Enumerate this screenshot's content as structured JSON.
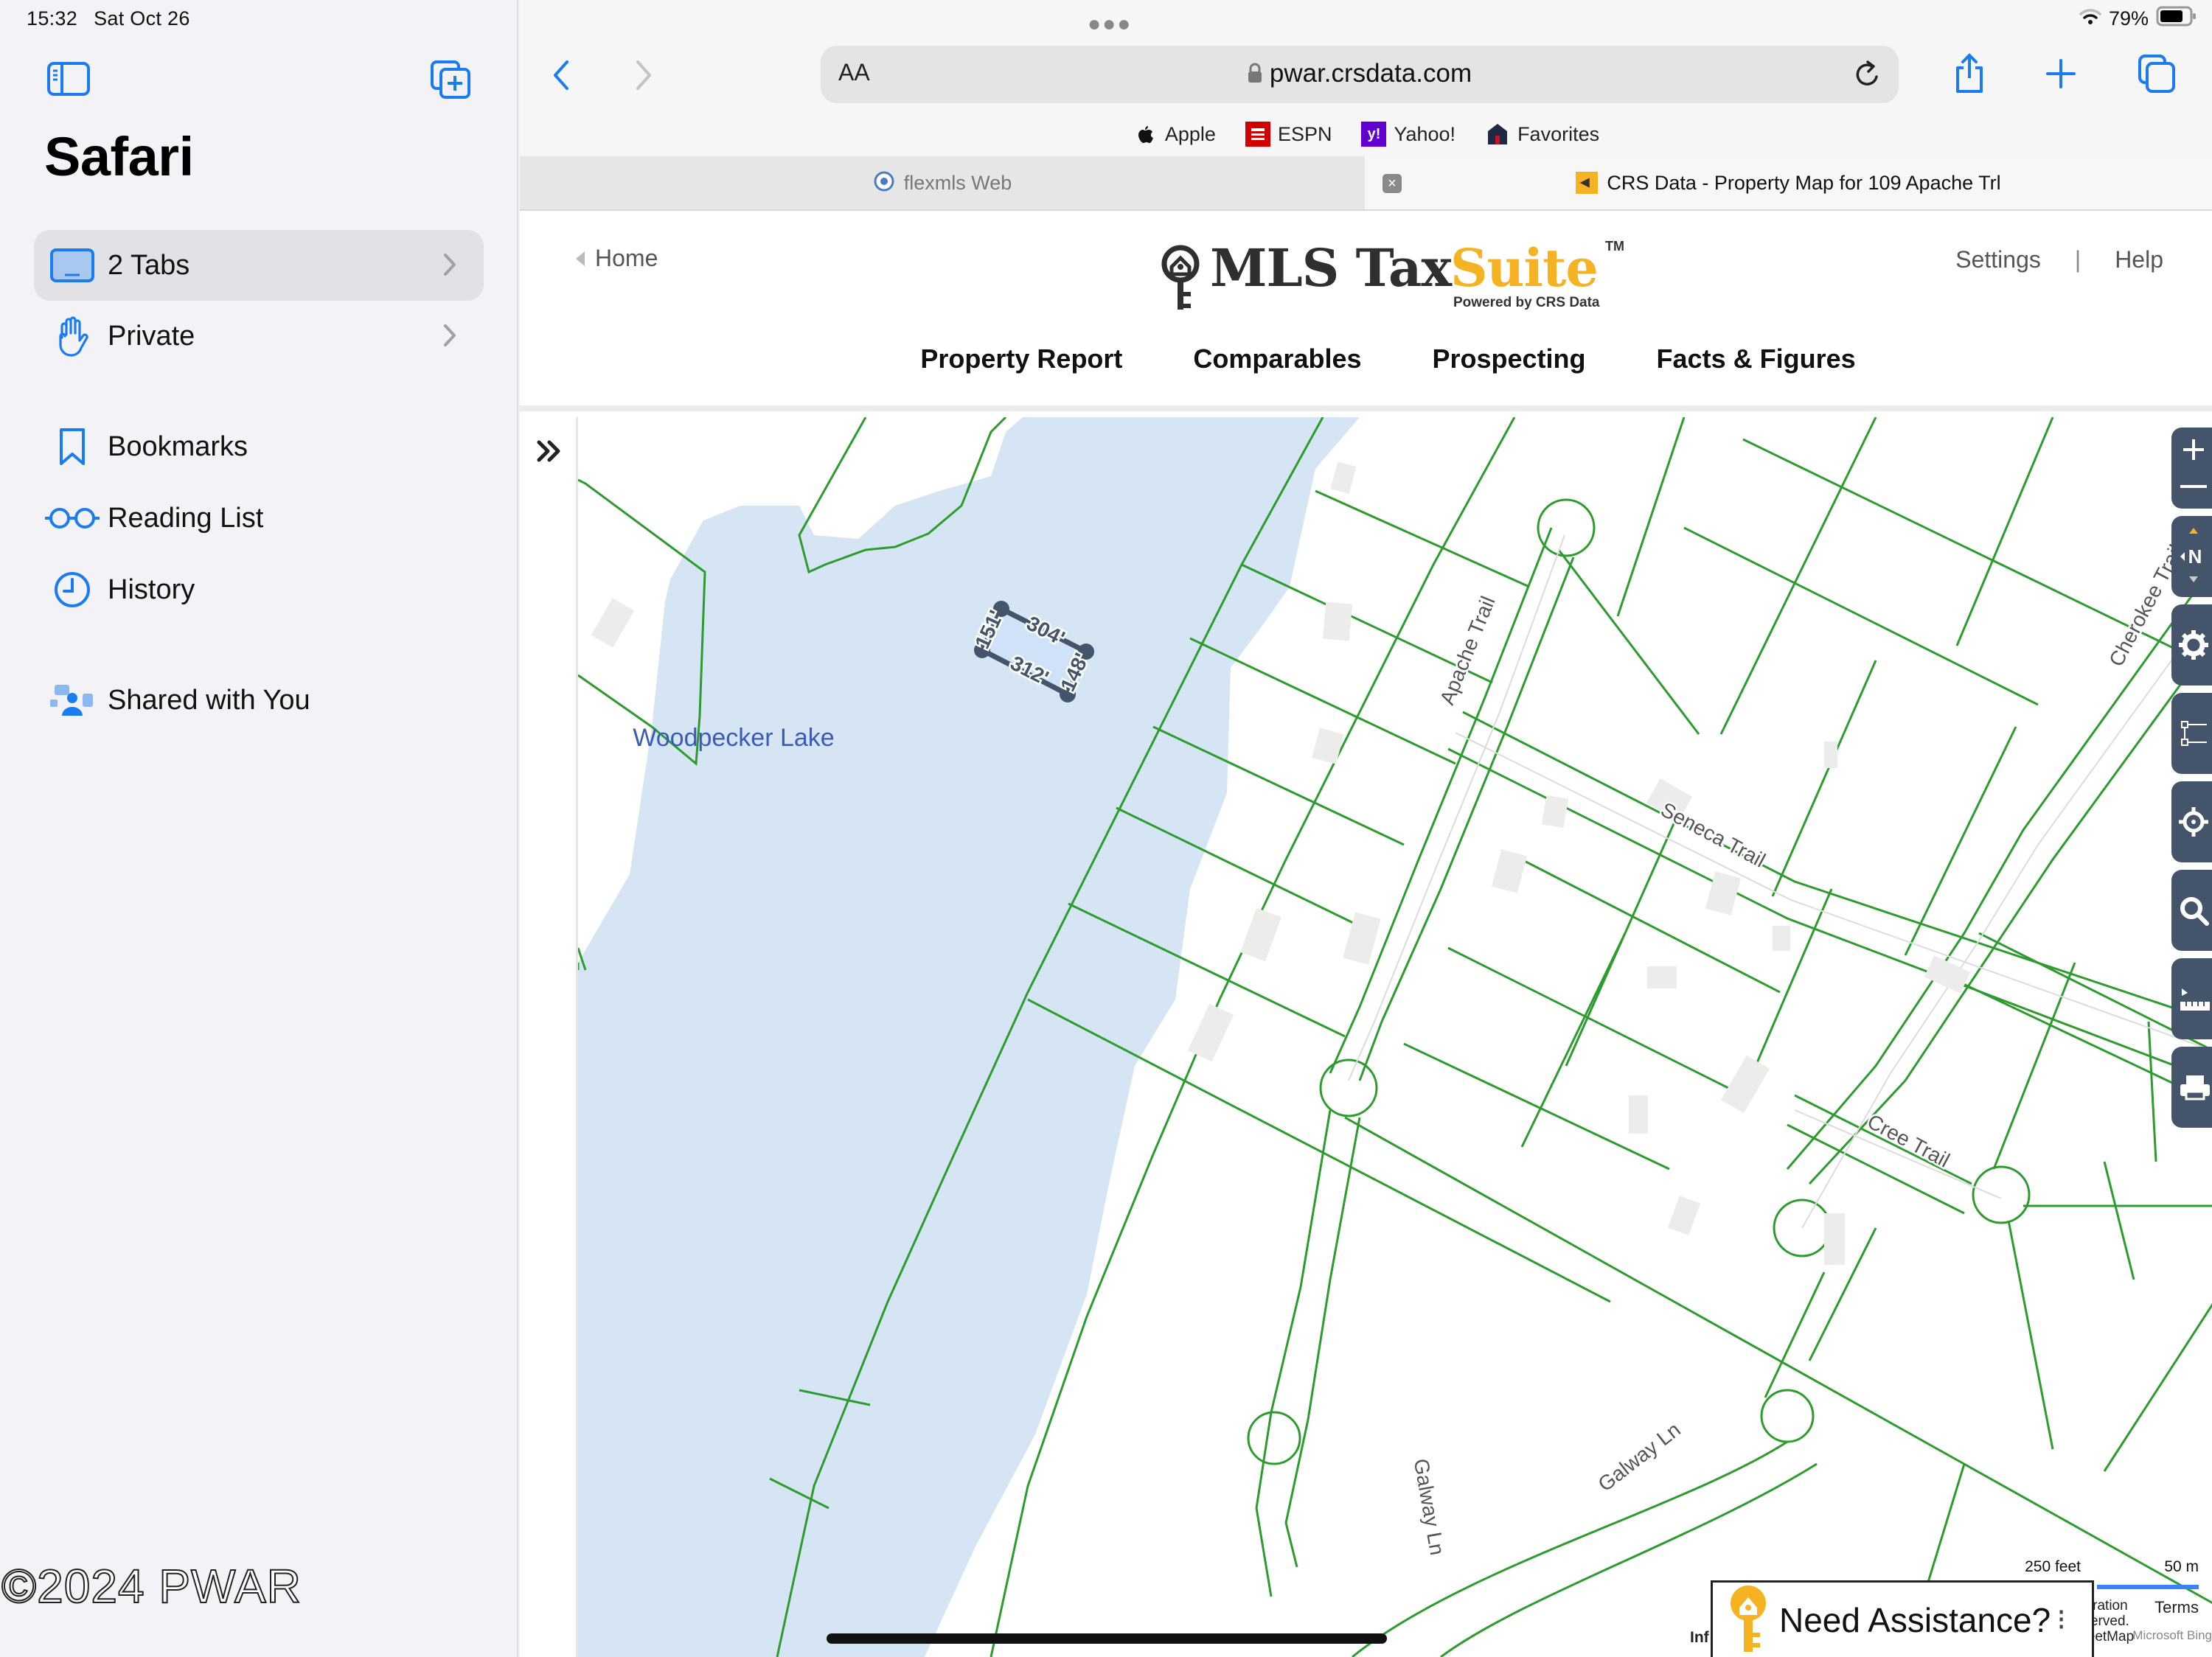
{
  "status_bar": {
    "time": "15:32",
    "date": "Sat Oct 26",
    "battery": "79%",
    "battery_level": 0.79
  },
  "sidebar": {
    "title": "Safari",
    "items": [
      {
        "label": "2 Tabs",
        "icon": "tabs-icon",
        "active": true,
        "chevron": true
      },
      {
        "label": "Private",
        "icon": "hand-icon",
        "active": false,
        "chevron": true
      },
      {
        "label": "Bookmarks",
        "icon": "bookmark-icon",
        "active": false,
        "chevron": false
      },
      {
        "label": "Reading List",
        "icon": "glasses-icon",
        "active": false,
        "chevron": false
      },
      {
        "label": "History",
        "icon": "clock-icon",
        "active": false,
        "chevron": false
      },
      {
        "label": "Shared with You",
        "icon": "shared-icon",
        "active": false,
        "chevron": false
      }
    ],
    "watermark": "©2024 PWAR"
  },
  "browser": {
    "url_aa": "AA",
    "url": "pwar.crsdata.com",
    "favorites": [
      {
        "label": "Apple",
        "icon": "apple-icon",
        "color": "#000000"
      },
      {
        "label": "ESPN",
        "icon": "espn-icon",
        "color": "#d00000"
      },
      {
        "label": "Yahoo!",
        "icon": "yahoo-icon",
        "color": "#6001d2"
      },
      {
        "label": "Favorites",
        "icon": "favorites-icon",
        "color": "#1e2a44"
      }
    ],
    "tabs": [
      {
        "label": "flexmls Web",
        "active": false
      },
      {
        "label": "CRS Data - Property Map for 109 Apache Trl",
        "active": true
      }
    ]
  },
  "page": {
    "home_link": "Home",
    "logo": {
      "part1": "MLS Tax",
      "part2": "Suite",
      "tm": "TM",
      "tagline": "Powered by CRS Data",
      "accent": "#f5b223"
    },
    "header_links": {
      "settings": "Settings",
      "separator": "|",
      "help": "Help"
    },
    "nav": [
      "Property Report",
      "Comparables",
      "Prospecting",
      "Facts & Figures"
    ]
  },
  "map": {
    "lake_label": "Woodpecker Lake",
    "street_labels": [
      "Apache Trail",
      "Seneca Trail",
      "Cherokee Trail",
      "Cree Trail",
      "Galway Ln",
      "Galway Ln"
    ],
    "parcel_dimensions": {
      "north": "304'",
      "south": "312'",
      "west": "151'",
      "east": "148'"
    },
    "controls": [
      "zoom-in-out",
      "compass",
      "settings",
      "select",
      "locate",
      "search",
      "measure",
      "print"
    ],
    "compass_label": "N",
    "scale": {
      "imperial": "250 feet",
      "metric": "50 m"
    },
    "attribution": {
      "lines": [
        "oft Corporation",
        "ghts Reserved.",
        "OpenStreetMap"
      ],
      "terms": "Terms",
      "bing": "Microsoft Bing",
      "info_fragment": "Inf"
    },
    "assist_label": "Need Assistance?",
    "colors": {
      "parcel_line": "#2e9b2e",
      "water": "#d6e5f3",
      "selected_fill": "#cfe1f7",
      "selected_stroke": "#44546a"
    }
  }
}
